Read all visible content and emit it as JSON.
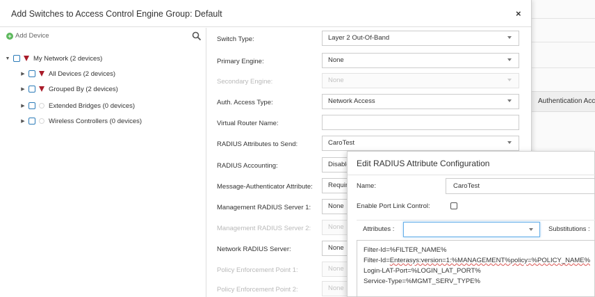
{
  "dialog": {
    "title": "Add Switches to Access Control Engine Group: Default",
    "close_symbol": "×"
  },
  "tree": {
    "add_device_label": "Add Device",
    "nodes": [
      {
        "label": "My Network (2 devices)",
        "expanded": true,
        "marker": "triangle"
      },
      {
        "label": "All Devices (2 devices)",
        "expanded": false,
        "marker": "triangle"
      },
      {
        "label": "Grouped By (2 devices)",
        "expanded": false,
        "marker": "triangle"
      },
      {
        "label": "Extended Bridges (0 devices)",
        "expanded": false,
        "marker": "circle"
      },
      {
        "label": "Wireless Controllers (0 devices)",
        "expanded": false,
        "marker": "circle"
      }
    ]
  },
  "form": {
    "switch_type": {
      "label": "Switch Type:",
      "value": "Layer 2 Out-Of-Band"
    },
    "primary_engine": {
      "label": "Primary Engine:",
      "value": "None"
    },
    "secondary_engine": {
      "label": "Secondary Engine:",
      "value": "None"
    },
    "auth_access_type": {
      "label": "Auth. Access Type:",
      "value": "Network Access"
    },
    "virtual_router_name": {
      "label": "Virtual Router Name:",
      "value": ""
    },
    "radius_attributes": {
      "label": "RADIUS Attributes to Send:",
      "value": "CaroTest"
    },
    "radius_accounting": {
      "label": "RADIUS Accounting:",
      "value": "Disabled"
    },
    "message_authenticator": {
      "label": "Message-Authenticator Attribute:",
      "value": "Required"
    },
    "mgmt_radius_1": {
      "label": "Management RADIUS Server 1:",
      "value": "None"
    },
    "mgmt_radius_2": {
      "label": "Management RADIUS Server 2:",
      "value": "None"
    },
    "network_radius": {
      "label": "Network RADIUS Server:",
      "value": "None"
    },
    "pep_1": {
      "label": "Policy Enforcement Point 1:",
      "value": "None"
    },
    "pep_2": {
      "label": "Policy Enforcement Point 2:",
      "value": "None"
    }
  },
  "background": {
    "authentication_column": "Authentication Access"
  },
  "radius_dialog": {
    "title": "Edit RADIUS Attribute Configuration",
    "name_label": "Name:",
    "name_value": "CaroTest",
    "port_link_label": "Enable Port Link Control:",
    "port_link_checked": false,
    "attributes_label": "Attributes :",
    "attributes_value": "",
    "substitutions_label": "Substitutions :",
    "attribute_lines": {
      "line1": "Filter-Id=%FILTER_NAME%",
      "line2_prefix": "Filter-Id=",
      "line2_squiggle": "Enterasys:version=1:%MANAGEMENT%policy=%POLICY_NAME%",
      "line3": "Login-LAT-Port=%LOGIN_LAT_PORT%",
      "line4": "Service-Type=%MGMT_SERV_TYPE%"
    }
  },
  "colors": {
    "checkbox_border": "#2a7ab8",
    "tree_marker": "#a91c2a",
    "add_icon": "#5cb85c",
    "focus_border": "#66afe9"
  }
}
